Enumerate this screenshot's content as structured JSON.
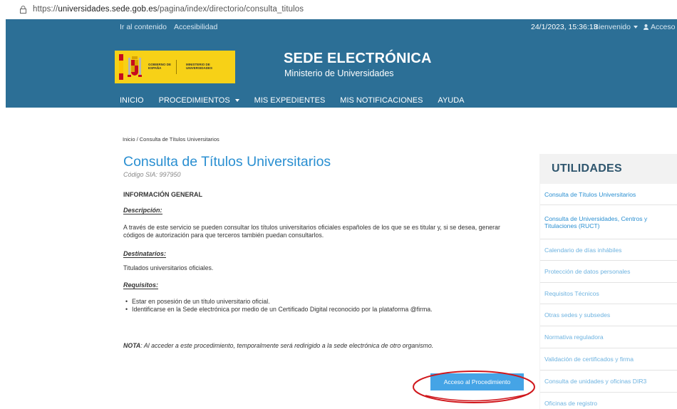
{
  "browser": {
    "url_prefix": "https://",
    "url_host": "universidades.sede.gob.es",
    "url_path": "/pagina/index/directorio/consulta_titulos"
  },
  "topbar": {
    "skip_link": "Ir al contenido",
    "accessibility_link": "Accesibilidad",
    "datetime": "24/1/2023, 15:36:13",
    "welcome": "Bienvenido",
    "login": "Acceso"
  },
  "logo": {
    "line1": "GOBIERNO DE ESPAÑA",
    "line2": "MINISTERIO DE UNIVERSIDADES"
  },
  "site": {
    "title": "SEDE ELECTRÓNICA",
    "subtitle": "Ministerio de Universidades"
  },
  "nav": {
    "items": [
      "INICIO",
      "PROCEDIMIENTOS",
      "MIS EXPEDIENTES",
      "MIS NOTIFICACIONES",
      "AYUDA"
    ]
  },
  "breadcrumb": "Inicio / Consulta de Títulos Universitarios",
  "page": {
    "title": "Consulta de Títulos Universitarios",
    "sia": "Código SIA: 997950",
    "section_heading": "INFORMACIÓN GENERAL",
    "desc_label": "Descripción",
    "desc_text": "A través de este servicio se pueden consultar los títulos universitarios oficiales españoles de los que se es titular y, si se desea, generar códigos de autorización para que terceros también puedan consultarlos.",
    "dest_label": "Destinatarios:",
    "dest_text": "Titulados universitarios oficiales.",
    "req_label": "Requisitos:",
    "requirements": [
      "Estar en posesión de un título universitario oficial.",
      "Identificarse en la Sede electrónica por medio de un Certificado Digital reconocido por la plataforma @firma."
    ],
    "nota_label": "NOTA",
    "nota_text": ": Al acceder a este procedimiento, temporalmente será redirigido a la sede electrónica de otro organismo.",
    "access_button": "Acceso al Procedimiento"
  },
  "sidebar": {
    "title": "UTILIDADES",
    "items": [
      "Consulta de Títulos Universitarios",
      "Consulta de Universidades, Centros y Titulaciones (RUCT)",
      "Calendario de días inhábiles",
      "Protección de datos personales",
      "Requisitos Técnicos",
      "Otras sedes y subsedes",
      "Normativa reguladora",
      "Validación de certificados y firma",
      "Consulta de unidades y oficinas DIR3",
      "Oficinas de registro"
    ]
  },
  "colors": {
    "header_blue": "#2c6f96",
    "link_blue": "#2a8fd1",
    "button_blue": "#45a4e6",
    "annotation_red": "#d0171c",
    "logo_yellow": "#f7d117"
  }
}
